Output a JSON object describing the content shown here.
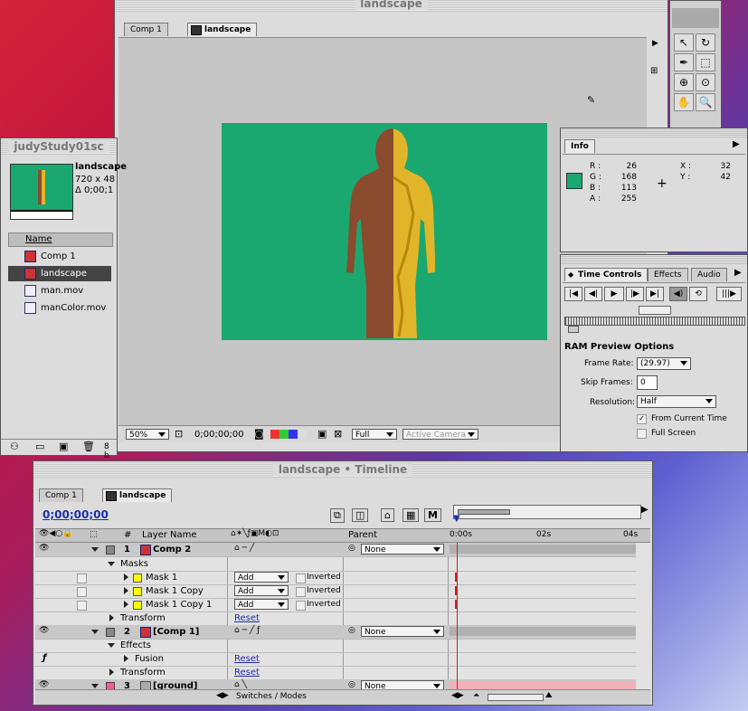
{
  "comp_window": {
    "title": "landscape",
    "tabs": [
      "Comp 1",
      "landscape"
    ],
    "zoom": "50%",
    "timecode": "0;00;00;00",
    "resolution": "Full",
    "camera": "Active Camera"
  },
  "project_window": {
    "title": "judyStudy01sc",
    "selected_name": "landscape",
    "selected_size": "720 x 48",
    "selected_duration": "Δ 0;00;1",
    "column_name": "Name",
    "items": [
      {
        "name": "Comp 1",
        "icon": "comp-icon"
      },
      {
        "name": "landscape",
        "icon": "comp-icon"
      },
      {
        "name": "man.mov",
        "icon": "movie-icon"
      },
      {
        "name": "manColor.mov",
        "icon": "movie-icon"
      }
    ],
    "bit_depth": "8 b"
  },
  "info_panel": {
    "tab": "Info",
    "r_label": "R :",
    "r": "26",
    "g_label": "G :",
    "g": "168",
    "b_label": "B :",
    "b": "113",
    "a_label": "A :",
    "a": "255",
    "x_label": "X :",
    "x": "32",
    "y_label": "Y :",
    "y": "42",
    "swatch_color": "#1aa870"
  },
  "time_controls": {
    "tabs": [
      "Time Controls",
      "Effects",
      "Audio"
    ],
    "ram_preview_heading": "RAM Preview Options",
    "frame_rate_label": "Frame Rate:",
    "frame_rate": "(29.97)",
    "skip_frames_label": "Skip Frames:",
    "skip_frames": "0",
    "resolution_label": "Resolution:",
    "resolution": "Half",
    "from_current_time": "From Current Time",
    "full_screen": "Full Screen"
  },
  "timeline": {
    "title": "landscape • Timeline",
    "tabs": [
      "Comp 1",
      "landscape"
    ],
    "timecode": "0;00;00;00",
    "col_layer_name": "Layer Name",
    "col_parent": "Parent",
    "col_number": "#",
    "ruler": [
      "0:00s",
      "02s",
      "04s"
    ],
    "rows": [
      {
        "num": "1",
        "name": "Comp 2",
        "parent": "None"
      },
      {
        "label": "Masks"
      },
      {
        "name": "Mask 1",
        "mode": "Add",
        "inverted": "Inverted"
      },
      {
        "name": "Mask 1 Copy",
        "mode": "Add",
        "inverted": "Inverted"
      },
      {
        "name": "Mask 1 Copy 1",
        "mode": "Add",
        "inverted": "Inverted"
      },
      {
        "label": "Transform",
        "value": "Reset"
      },
      {
        "num": "2",
        "name": "[Comp 1]",
        "parent": "None"
      },
      {
        "label": "Effects"
      },
      {
        "label": "Fusion",
        "value": "Reset"
      },
      {
        "label": "Transform",
        "value": "Reset"
      },
      {
        "num": "3",
        "name": "[ground]",
        "parent": "None"
      }
    ],
    "switches_modes": "Switches / Modes"
  },
  "colors": {
    "comp_bg": "#1aa870",
    "timeline_accent": "#1a2fa8",
    "playhead": "#d02020"
  }
}
